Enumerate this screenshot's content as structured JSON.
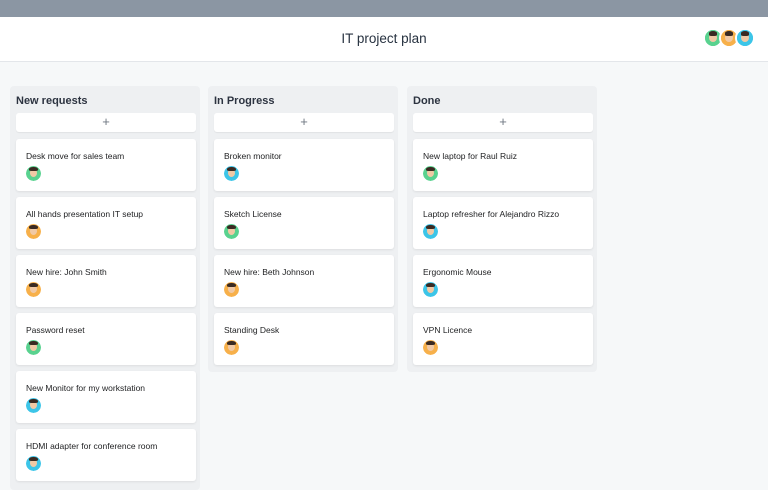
{
  "header": {
    "title": "IT project plan",
    "members": [
      {
        "icon": "user-avatar-icon",
        "color": "#59d28f"
      },
      {
        "icon": "user-avatar-icon",
        "color": "#f7b04a"
      },
      {
        "icon": "user-avatar-icon",
        "color": "#3cc5e8"
      }
    ]
  },
  "add_label": "+",
  "columns": [
    {
      "title": "New requests",
      "cards": [
        {
          "title": "Desk move for sales team",
          "avatar_color": "green"
        },
        {
          "title": "All hands presentation IT setup",
          "avatar_color": "orange"
        },
        {
          "title": "New hire: John Smith",
          "avatar_color": "orange"
        },
        {
          "title": "Password reset",
          "avatar_color": "green"
        },
        {
          "title": "New Monitor for my workstation",
          "avatar_color": "blue"
        },
        {
          "title": "HDMI adapter for conference room",
          "avatar_color": "blue"
        }
      ]
    },
    {
      "title": "In Progress",
      "cards": [
        {
          "title": "Broken monitor",
          "avatar_color": "blue"
        },
        {
          "title": "Sketch License",
          "avatar_color": "green"
        },
        {
          "title": "New hire: Beth Johnson",
          "avatar_color": "orange"
        },
        {
          "title": "Standing Desk",
          "avatar_color": "orange"
        }
      ]
    },
    {
      "title": "Done",
      "cards": [
        {
          "title": "New laptop for Raul Ruiz",
          "avatar_color": "green"
        },
        {
          "title": "Laptop refresher for Alejandro Rizzo",
          "avatar_color": "blue"
        },
        {
          "title": "Ergonomic Mouse",
          "avatar_color": "blue"
        },
        {
          "title": "VPN Licence",
          "avatar_color": "orange"
        }
      ]
    }
  ]
}
